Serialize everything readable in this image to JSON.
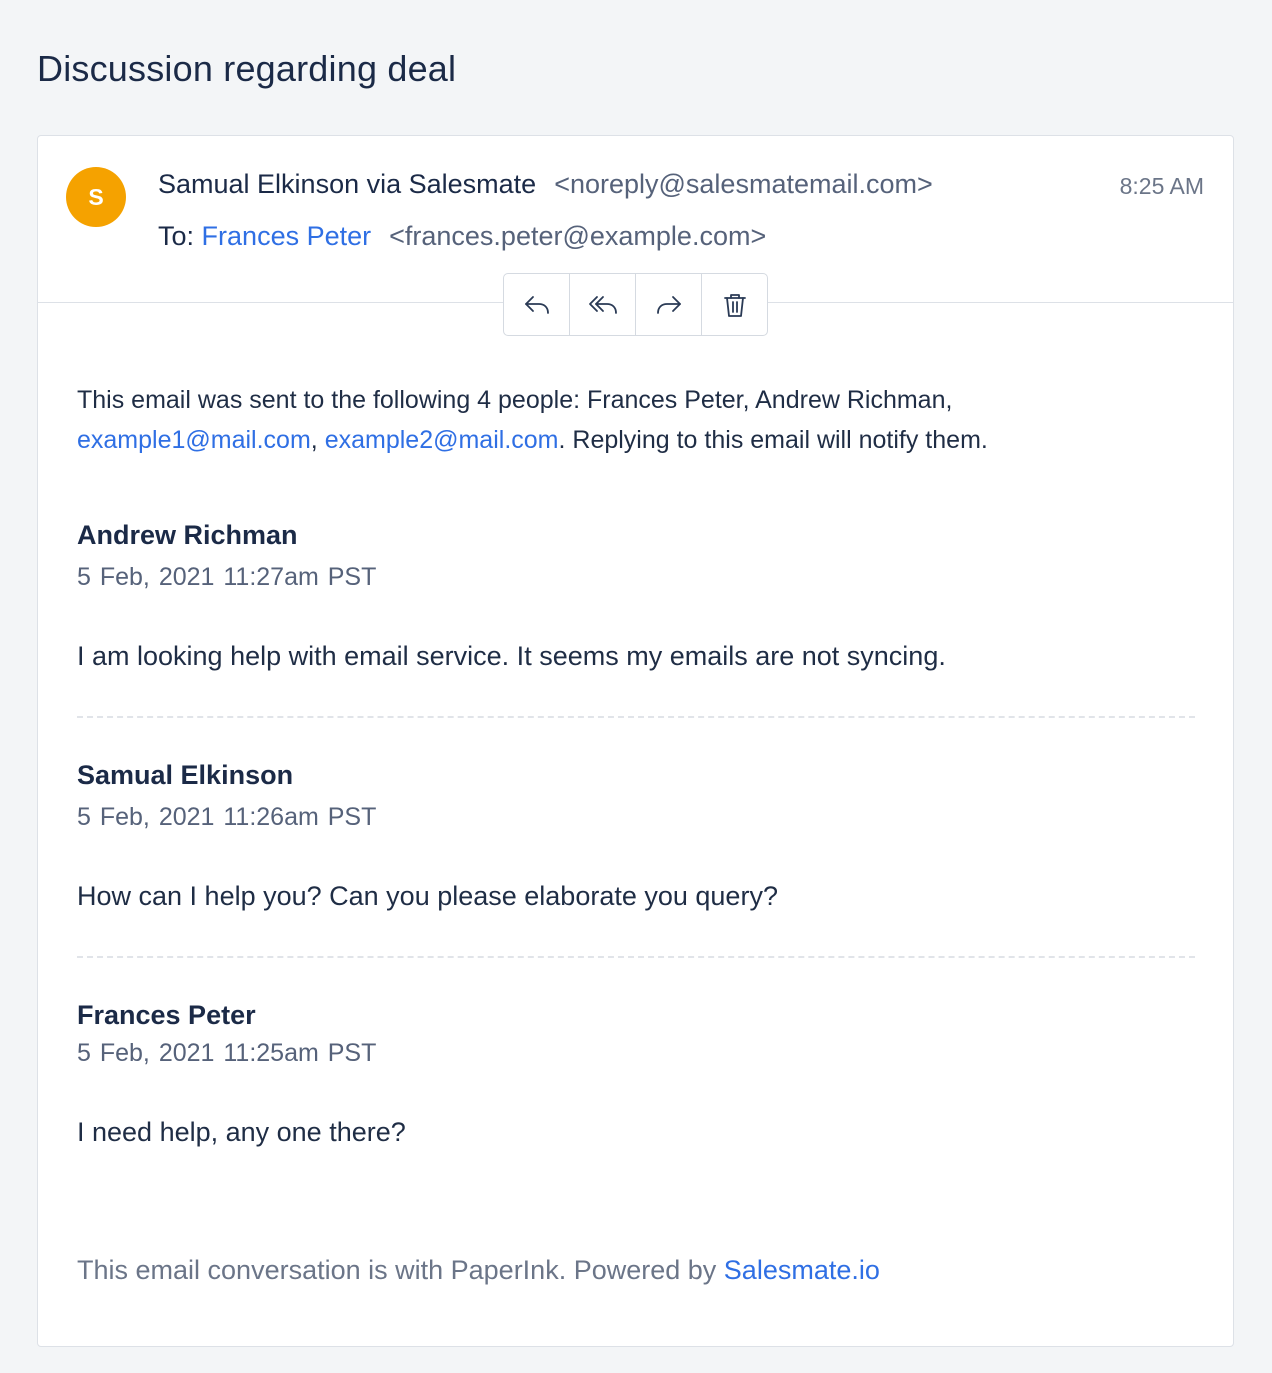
{
  "page": {
    "title": "Discussion regarding deal"
  },
  "email": {
    "avatar_initial": "S",
    "from_name": "Samual Elkinson via Salesmate",
    "from_email": "<noreply@salesmatemail.com>",
    "time": "8:25 AM",
    "to_label": "To:",
    "to_name": "Frances Peter",
    "to_email": "<frances.peter@example.com>"
  },
  "actions": [
    {
      "name": "reply",
      "icon": "reply-icon"
    },
    {
      "name": "reply-all",
      "icon": "reply-all-icon"
    },
    {
      "name": "forward",
      "icon": "forward-icon"
    },
    {
      "name": "delete",
      "icon": "trash-icon"
    }
  ],
  "notice": {
    "prefix": "This email was sent to the following 4 people: Frances Peter, Andrew Richman,",
    "link1": "example1@mail.com",
    "sep": ", ",
    "link2": "example2@mail.com",
    "suffix": ". Replying to this email will notify them."
  },
  "messages": [
    {
      "author": "Andrew Richman",
      "date": "5 Feb, 2021  11:27am PST",
      "body": "I am looking help with email service. It seems my emails are not syncing."
    },
    {
      "author": "Samual Elkinson",
      "date": "5 Feb, 2021  11:26am PST",
      "body": "How can I help you? Can you please elaborate you query?"
    },
    {
      "author": "Frances Peter",
      "date": "5 Feb, 2021  11:25am PST",
      "body": "I need help, any one there?"
    }
  ],
  "footer": {
    "text": "This email conversation is with PaperInk. Powered by ",
    "link": "Salesmate.io"
  },
  "colors": {
    "accent": "#2f6fe4",
    "avatar": "#f5a200",
    "background": "#f3f5f7"
  }
}
